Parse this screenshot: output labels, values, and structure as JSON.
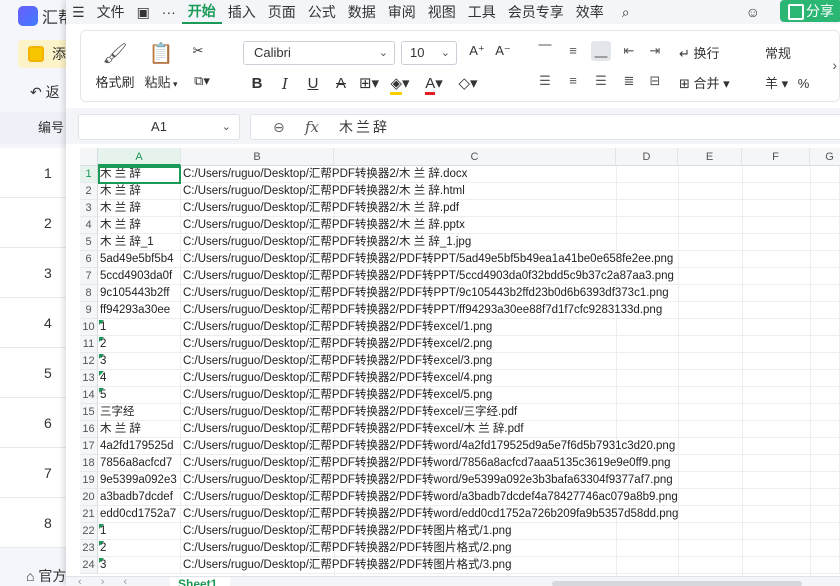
{
  "bg_app": {
    "title": "汇帮",
    "add_label": "添",
    "back_label": "返",
    "column_label": "编号",
    "rows": [
      "1",
      "2",
      "3",
      "4",
      "5",
      "6",
      "7",
      "8"
    ],
    "bottom_label": "官方"
  },
  "menubar": {
    "file": "文件",
    "items": [
      "开始",
      "插入",
      "页面",
      "公式",
      "数据",
      "审阅",
      "视图",
      "工具",
      "会员专享",
      "效率"
    ],
    "active": "开始",
    "share": "分享"
  },
  "ribbon": {
    "format_painter": "格式刷",
    "paste": "粘贴",
    "font_name": "Calibri",
    "font_size": "10",
    "wrap": "换行",
    "merge": "合并",
    "number_format": "常规",
    "currency_symbol": "羊",
    "percent": "%"
  },
  "formula_bar": {
    "cell_ref": "A1",
    "fx": "fx",
    "value": "木兰辞"
  },
  "columns": [
    "A",
    "B",
    "C",
    "D",
    "E",
    "F",
    "G"
  ],
  "selected_column": "A",
  "rows": [
    {
      "n": "1",
      "a": "木 兰 辞",
      "b": "C:/Users/ruguo/Desktop/汇帮PDF转换器2/木 兰 辞.docx",
      "tri": false
    },
    {
      "n": "2",
      "a": "木 兰 辞",
      "b": "C:/Users/ruguo/Desktop/汇帮PDF转换器2/木 兰 辞.html",
      "tri": false
    },
    {
      "n": "3",
      "a": "木 兰 辞",
      "b": "C:/Users/ruguo/Desktop/汇帮PDF转换器2/木 兰 辞.pdf",
      "tri": false
    },
    {
      "n": "4",
      "a": "木 兰 辞",
      "b": "C:/Users/ruguo/Desktop/汇帮PDF转换器2/木 兰 辞.pptx",
      "tri": false
    },
    {
      "n": "5",
      "a": "木 兰 辞_1",
      "b": "C:/Users/ruguo/Desktop/汇帮PDF转换器2/木 兰 辞_1.jpg",
      "tri": false
    },
    {
      "n": "6",
      "a": "5ad49e5bf5b4",
      "b": "C:/Users/ruguo/Desktop/汇帮PDF转换器2/PDF转PPT/5ad49e5bf5b49ea1a41be0e658fe2ee.png",
      "tri": false
    },
    {
      "n": "7",
      "a": "5ccd4903da0f",
      "b": "C:/Users/ruguo/Desktop/汇帮PDF转换器2/PDF转PPT/5ccd4903da0f32bdd5c9b37c2a87aa3.png",
      "tri": false
    },
    {
      "n": "8",
      "a": "9c105443b2ff",
      "b": "C:/Users/ruguo/Desktop/汇帮PDF转换器2/PDF转PPT/9c105443b2ffd23b0d6b6393df373c1.png",
      "tri": false
    },
    {
      "n": "9",
      "a": "ff94293a30ee",
      "b": "C:/Users/ruguo/Desktop/汇帮PDF转换器2/PDF转PPT/ff94293a30ee88f7d1f7cfc9283133d.png",
      "tri": false
    },
    {
      "n": "10",
      "a": "1",
      "b": "C:/Users/ruguo/Desktop/汇帮PDF转换器2/PDF转excel/1.png",
      "tri": true
    },
    {
      "n": "11",
      "a": "2",
      "b": "C:/Users/ruguo/Desktop/汇帮PDF转换器2/PDF转excel/2.png",
      "tri": true
    },
    {
      "n": "12",
      "a": "3",
      "b": "C:/Users/ruguo/Desktop/汇帮PDF转换器2/PDF转excel/3.png",
      "tri": true
    },
    {
      "n": "13",
      "a": "4",
      "b": "C:/Users/ruguo/Desktop/汇帮PDF转换器2/PDF转excel/4.png",
      "tri": true
    },
    {
      "n": "14",
      "a": "5",
      "b": "C:/Users/ruguo/Desktop/汇帮PDF转换器2/PDF转excel/5.png",
      "tri": true
    },
    {
      "n": "15",
      "a": "三字经",
      "b": "C:/Users/ruguo/Desktop/汇帮PDF转换器2/PDF转excel/三字经.pdf",
      "tri": false
    },
    {
      "n": "16",
      "a": "木 兰 辞",
      "b": "C:/Users/ruguo/Desktop/汇帮PDF转换器2/PDF转excel/木 兰 辞.pdf",
      "tri": false
    },
    {
      "n": "17",
      "a": "4a2fd179525d",
      "b": "C:/Users/ruguo/Desktop/汇帮PDF转换器2/PDF转word/4a2fd179525d9a5e7f6d5b7931c3d20.png",
      "tri": false
    },
    {
      "n": "18",
      "a": "7856a8acfcd7",
      "b": "C:/Users/ruguo/Desktop/汇帮PDF转换器2/PDF转word/7856a8acfcd7aaa5135c3619e9e0ff9.png",
      "tri": false
    },
    {
      "n": "19",
      "a": "9e5399a092e3",
      "b": "C:/Users/ruguo/Desktop/汇帮PDF转换器2/PDF转word/9e5399a092e3b3bafa63304f9377af7.png",
      "tri": false
    },
    {
      "n": "20",
      "a": "a3badb7dcdef",
      "b": "C:/Users/ruguo/Desktop/汇帮PDF转换器2/PDF转word/a3badb7dcdef4a78427746ac079a8b9.png",
      "tri": false
    },
    {
      "n": "21",
      "a": "edd0cd1752a7",
      "b": "C:/Users/ruguo/Desktop/汇帮PDF转换器2/PDF转word/edd0cd1752a726b209fa9b5357d58dd.png",
      "tri": false
    },
    {
      "n": "22",
      "a": "1",
      "b": "C:/Users/ruguo/Desktop/汇帮PDF转换器2/PDF转图片格式/1.png",
      "tri": true
    },
    {
      "n": "23",
      "a": "2",
      "b": "C:/Users/ruguo/Desktop/汇帮PDF转换器2/PDF转图片格式/2.png",
      "tri": true
    },
    {
      "n": "24",
      "a": "3",
      "b": "C:/Users/ruguo/Desktop/汇帮PDF转换器2/PDF转图片格式/3.png",
      "tri": true
    }
  ],
  "sheet_tab": "Sheet1",
  "colors": {
    "accent": "#1a9a57",
    "share": "#2bb673"
  }
}
